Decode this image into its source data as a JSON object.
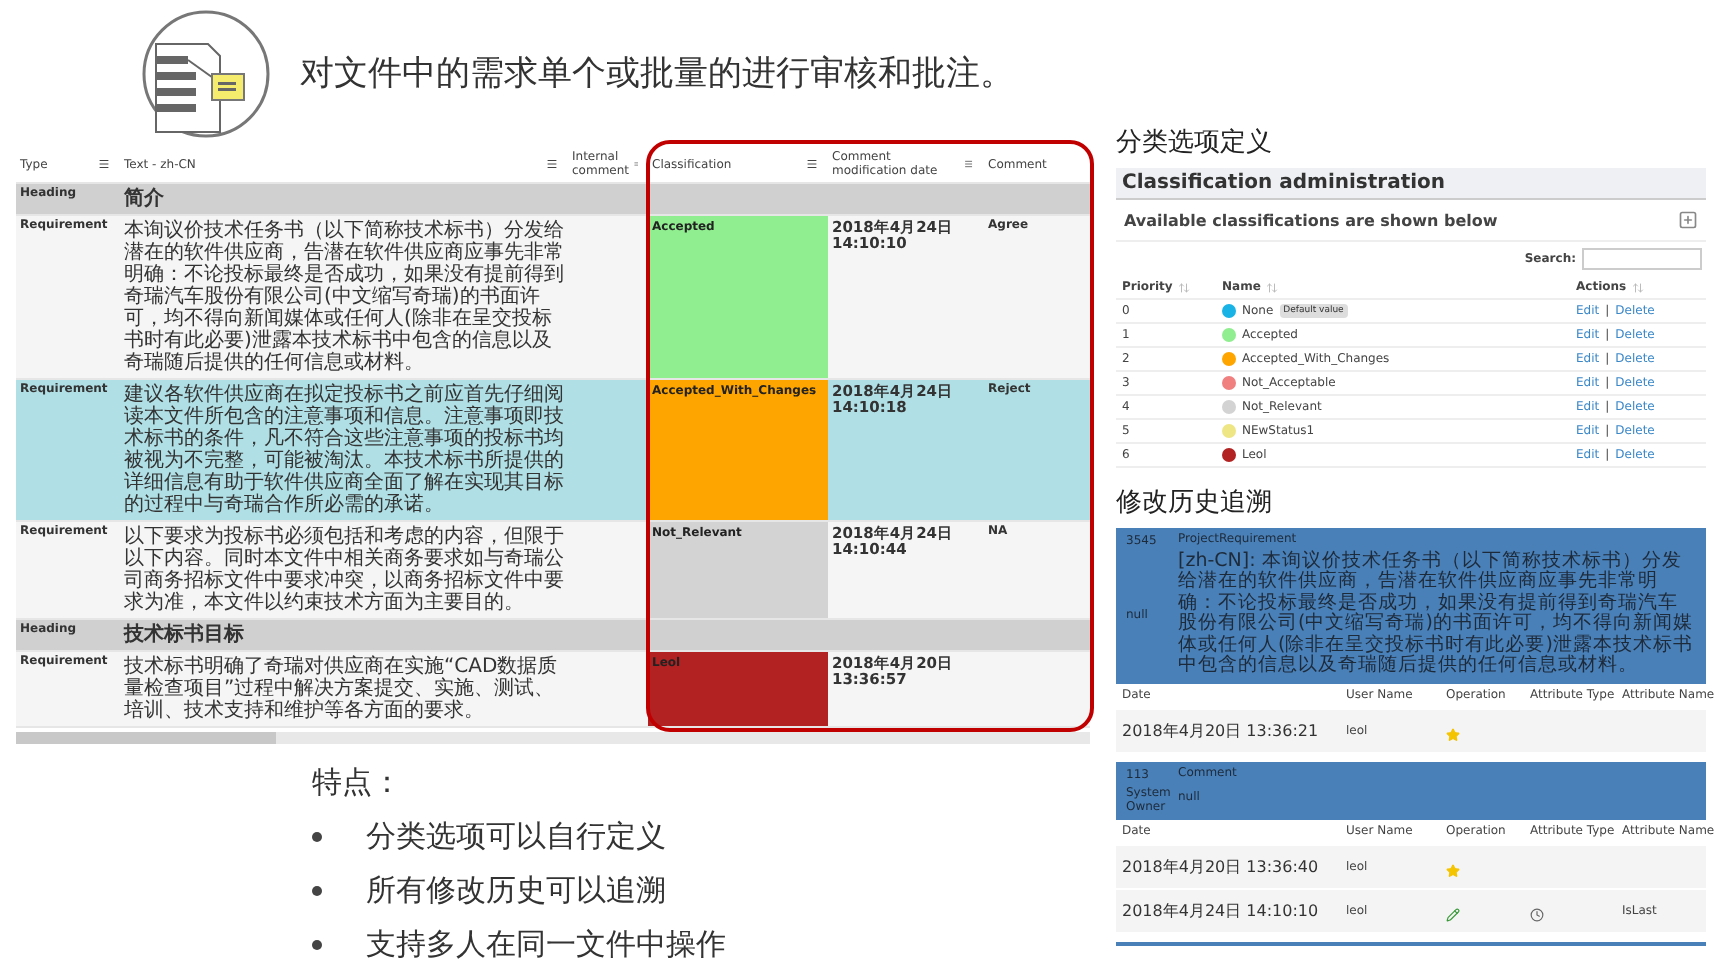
{
  "header": {
    "title": "对文件中的需求单个或批量的进行审核和批注。"
  },
  "review_table": {
    "columns": [
      "Type",
      "Text - zh-CN",
      "Internal comment",
      "Classification",
      "Comment modification date",
      "Comment"
    ],
    "rows": [
      {
        "kind": "heading",
        "type": "Heading",
        "text": "简介",
        "selected": false
      },
      {
        "kind": "requirement",
        "type": "Requirement",
        "text": "本询议价技术任务书（以下简称技术标书）分发给潜在的软件供应商，告潜在软件供应商应事先非常明确：不论投标最终是否成功，如果没有提前得到奇瑞汽车股份有限公司(中文缩写奇瑞)的书面许可，均不得向新闻媒体或任何人(除非在呈交投标书时有此必要)泄露本技术标书中包含的信息以及奇瑞随后提供的任何信息或材料。",
        "classification": "Accepted",
        "color": "#90ee90",
        "date": "2018年4月24日 14:10:10",
        "comment": "Agree",
        "selected": false
      },
      {
        "kind": "requirement",
        "type": "Requirement",
        "text": "建议各软件供应商在拟定投标书之前应首先仔细阅读本文件所包含的注意事项和信息。注意事项即技术标书的条件，凡不符合这些注意事项的投标书均被视为不完整，可能被淘汰。本技术标书所提供的详细信息有助于软件供应商全面了解在实现其目标的过程中与奇瑞合作所必需的承诺。",
        "classification": "Accepted_With_Changes",
        "color": "#ffa500",
        "date": "2018年4月24日 14:10:18",
        "comment": "Reject",
        "selected": true
      },
      {
        "kind": "requirement",
        "type": "Requirement",
        "text": "以下要求为投标书必须包括和考虑的内容，但限于以下内容。同时本文件中相关商务要求如与奇瑞公司商务招标文件中要求冲突，以商务招标文件中要求为准，本文件以约束技术方面为主要目的。",
        "classification": "Not_Relevant",
        "color": "#d3d3d3",
        "date": "2018年4月24日 14:10:44",
        "comment": "NA",
        "selected": false
      },
      {
        "kind": "heading",
        "type": "Heading",
        "text": "技术标书目标",
        "selected": false
      },
      {
        "kind": "requirement",
        "type": "Requirement",
        "text": "技术标书明确了奇瑞对供应商在实施“CAD数据质量检查项目”过程中解决方案提交、实施、测试、培训、技术支持和维护等各方面的要求。",
        "classification": "Leol",
        "color": "#b22222",
        "date": "2018年4月20日 13:36:57",
        "selected": false
      }
    ]
  },
  "features": {
    "title": "特点：",
    "items": [
      "分类选项可以自行定义",
      "所有修改历史可以追溯",
      "支持多人在同一文件中操作"
    ]
  },
  "classification_admin": {
    "section_title": "分类选项定义",
    "title": "Classification administration",
    "subtitle": "Available classifications are shown below",
    "search_label": "Search:",
    "columns": [
      "Priority",
      "Name",
      "Actions"
    ],
    "rows": [
      {
        "priority": "0",
        "name": "None",
        "badge": "Default value",
        "color": "#1ab3e6",
        "edit": "Edit",
        "separator": "|",
        "delete": "Delete"
      },
      {
        "priority": "1",
        "name": "Accepted",
        "color": "#90ee90",
        "edit": "Edit",
        "separator": "|",
        "delete": "Delete"
      },
      {
        "priority": "2",
        "name": "Accepted_With_Changes",
        "color": "#ffa500",
        "edit": "Edit",
        "separator": "|",
        "delete": "Delete"
      },
      {
        "priority": "3",
        "name": "Not_Acceptable",
        "color": "#f08080",
        "edit": "Edit",
        "separator": "|",
        "delete": "Delete"
      },
      {
        "priority": "4",
        "name": "Not_Relevant",
        "color": "#d3d3d3",
        "edit": "Edit",
        "separator": "|",
        "delete": "Delete"
      },
      {
        "priority": "5",
        "name": "NEwStatus1",
        "color": "#eee685",
        "edit": "Edit",
        "separator": "|",
        "delete": "Delete"
      },
      {
        "priority": "6",
        "name": "Leol",
        "color": "#b22222",
        "edit": "Edit",
        "separator": "|",
        "delete": "Delete"
      }
    ]
  },
  "history": {
    "section_title": "修改历史追溯",
    "entries": [
      {
        "fields": [
          {
            "label": "3545",
            "value": "ProjectRequirement"
          },
          {
            "label": "null",
            "value": "[zh-CN]: 本询议价技术任务书（以下简称技术标书）分发给潜在的软件供应商，告潜在软件供应商应事先非常明确：不论投标最终是否成功，如果没有提前得到奇瑞汽车股份有限公司(中文缩写奇瑞)的书面许可，均不得向新闻媒体或任何人(除非在呈交投标书时有此必要)泄露本技术标书中包含的信息以及奇瑞随后提供的任何信息或材料。"
          }
        ],
        "columns": [
          "Date",
          "User Name",
          "Operation",
          "Attribute Type",
          "Attribute Name"
        ],
        "rows": [
          {
            "date": "2018年4月20日 13:36:21",
            "user": "leol",
            "kind": "star",
            "clock": false
          }
        ]
      },
      {
        "fields": [
          {
            "label": "113",
            "value": "Comment"
          },
          {
            "label": "System Owner",
            "value": "null"
          }
        ],
        "columns": [
          "Date",
          "User Name",
          "Operation",
          "Attribute Type",
          "Attribute Name"
        ],
        "rows": [
          {
            "date": "2018年4月20日 13:36:40",
            "user": "leol",
            "kind": "star",
            "clock": false
          },
          {
            "date": "2018年4月24日 14:10:10",
            "user": "leol",
            "kind": "pencil",
            "clock": true,
            "attribute_name": "IsLast"
          }
        ]
      }
    ]
  }
}
